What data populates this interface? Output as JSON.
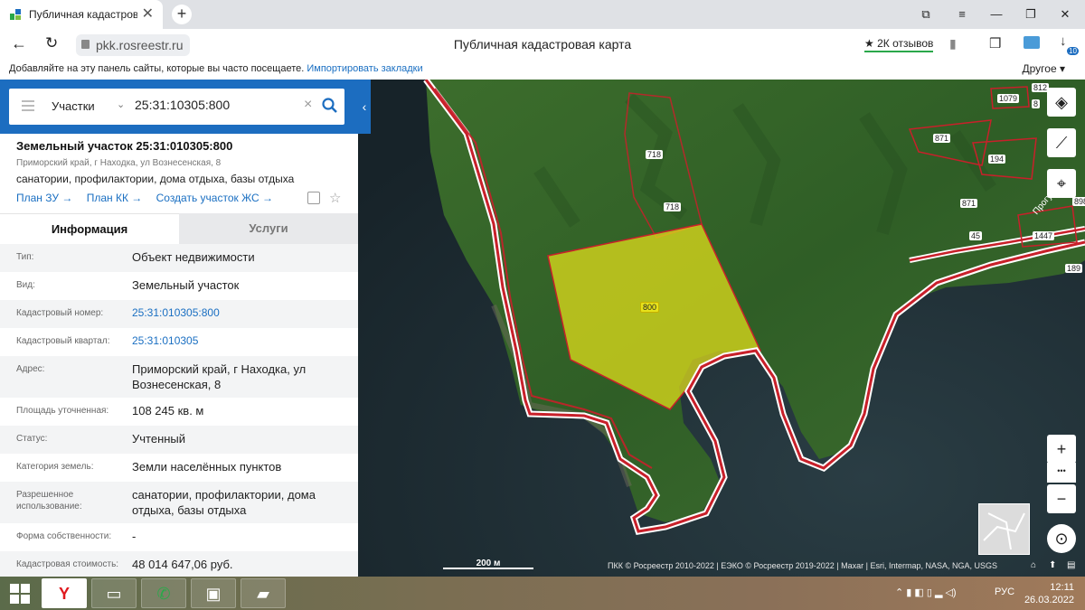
{
  "browser": {
    "tab_title": "Публичная кадастровая ка",
    "tab_close": "✕",
    "new_tab": "+",
    "url": "pkk.rosreestr.ru",
    "page_title": "Публичная кадастровая карта",
    "reviews": "★ 2К отзывов",
    "downloads_badge": "10",
    "bookmarks_hint": "Добавляйте на эту панель сайты, которые вы часто посещаете.",
    "bookmarks_import": "Импортировать закладки",
    "bookmarks_other": "Другое ▾"
  },
  "search": {
    "category": "Участки",
    "query": "25:31:10305:800"
  },
  "object": {
    "title": "Земельный участок 25:31:010305:800",
    "address_short": "Приморский край, г Находка, ул Вознесенская, 8",
    "use": "санатории, профилактории, дома отдыха, базы отдыха",
    "links": [
      "План ЗУ →",
      "План КК →",
      "Создать участок ЖС →"
    ]
  },
  "tabs": {
    "info": "Информация",
    "services": "Услуги"
  },
  "rows": [
    {
      "label": "Тип:",
      "value": "Объект недвижимости"
    },
    {
      "label": "Вид:",
      "value": "Земельный участок"
    },
    {
      "label": "Кадастровый номер:",
      "value": "25:31:010305:800",
      "link": true
    },
    {
      "label": "Кадастровый квартал:",
      "value": "25:31:010305",
      "link": true
    },
    {
      "label": "Адрес:",
      "value": "Приморский край, г Находка, ул Вознесенская, 8"
    },
    {
      "label": "Площадь уточненная:",
      "value": "108 245 кв. м"
    },
    {
      "label": "Статус:",
      "value": "Учтенный"
    },
    {
      "label": "Категория земель:",
      "value": "Земли населённых пунктов"
    },
    {
      "label": "Разрешенное использование:",
      "value": "санатории, профилактории, дома отдыха, базы отдыха"
    },
    {
      "label": "Форма собственности:",
      "value": "-"
    },
    {
      "label": "Кадастровая стоимость:",
      "value": "48 014 647,06 руб."
    }
  ],
  "map": {
    "parcel_labels": [
      "718",
      "718",
      "800",
      "871",
      "194",
      "871",
      "1079",
      "1447",
      "189",
      "898",
      "812",
      "8",
      "45"
    ],
    "road_label": "Прогулочная",
    "scale": "200 м",
    "copyright": "ПКК © Росреестр 2010-2022 | ЕЭКО © Росреестр 2019-2022 | Maxar | Esri, Intermap, NASA, NGA, USGS",
    "zoom_in": "+",
    "zoom_more": "•••",
    "zoom_out": "−",
    "colors": {
      "parcel_fill": "#e6e21a",
      "boundary": "#c8202a"
    }
  },
  "taskbar": {
    "time": "12:11",
    "date": "26.03.2022",
    "lang": "РУС"
  }
}
